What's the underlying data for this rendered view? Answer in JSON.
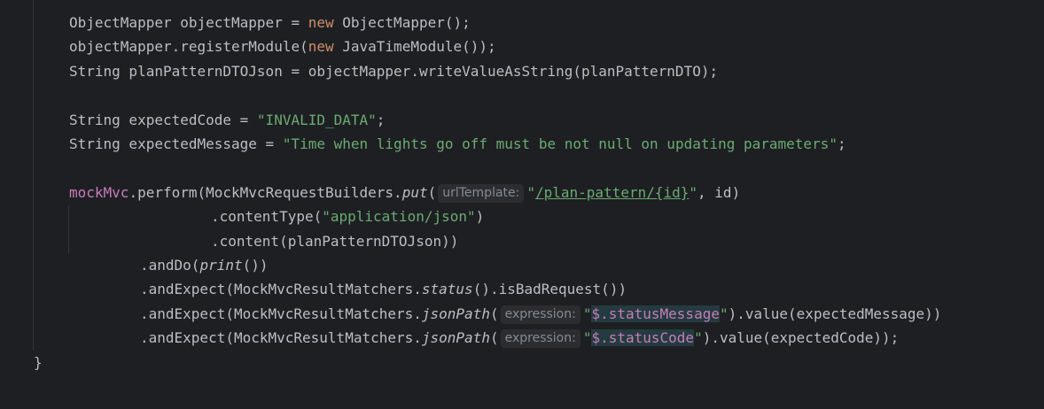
{
  "editor": {
    "lines": [
      {
        "indent": 4,
        "segments": [
          {
            "text": "ObjectMapper objectMapper = ",
            "cls": ""
          },
          {
            "text": "new",
            "cls": "kw"
          },
          {
            "text": " ObjectMapper();",
            "cls": ""
          }
        ]
      },
      {
        "indent": 4,
        "segments": [
          {
            "text": "objectMapper.registerModule(",
            "cls": ""
          },
          {
            "text": "new",
            "cls": "kw"
          },
          {
            "text": " JavaTimeModule());",
            "cls": ""
          }
        ]
      },
      {
        "indent": 4,
        "segments": [
          {
            "text": "String planPatternDTOJson = objectMapper.writeValueAsString(planPatternDTO);",
            "cls": ""
          }
        ]
      },
      {
        "indent": 0,
        "segments": []
      },
      {
        "indent": 4,
        "segments": [
          {
            "text": "String expectedCode = ",
            "cls": ""
          },
          {
            "text": "\"INVALID_DATA\"",
            "cls": "str"
          },
          {
            "text": ";",
            "cls": ""
          }
        ]
      },
      {
        "indent": 4,
        "segments": [
          {
            "text": "String expectedMessage = ",
            "cls": ""
          },
          {
            "text": "\"Time when lights go off must be not null on updating parameters\"",
            "cls": "str"
          },
          {
            "text": ";",
            "cls": ""
          }
        ]
      },
      {
        "indent": 0,
        "segments": []
      },
      {
        "indent": 4,
        "segments": [
          {
            "text": "mockMvc",
            "cls": "fld"
          },
          {
            "text": ".perform(MockMvcRequestBuilders.",
            "cls": ""
          },
          {
            "text": "put",
            "cls": "it"
          },
          {
            "text": "(",
            "cls": ""
          },
          {
            "hint": "urlTemplate:"
          },
          {
            "text": "\"",
            "cls": "str"
          },
          {
            "text": "/plan-pattern/{id}",
            "cls": "str url"
          },
          {
            "text": "\"",
            "cls": "str"
          },
          {
            "text": ", id)",
            "cls": ""
          }
        ]
      },
      {
        "indent": 20,
        "segments": [
          {
            "text": ".contentType(",
            "cls": ""
          },
          {
            "text": "\"application/json\"",
            "cls": "str"
          },
          {
            "text": ")",
            "cls": ""
          }
        ]
      },
      {
        "indent": 20,
        "segments": [
          {
            "text": ".content(planPatternDTOJson))",
            "cls": ""
          }
        ]
      },
      {
        "indent": 12,
        "segments": [
          {
            "text": ".andDo(",
            "cls": ""
          },
          {
            "text": "print",
            "cls": "it"
          },
          {
            "text": "())",
            "cls": ""
          }
        ]
      },
      {
        "indent": 12,
        "segments": [
          {
            "text": ".andExpect(MockMvcResultMatchers.",
            "cls": ""
          },
          {
            "text": "status",
            "cls": "it"
          },
          {
            "text": "().isBadRequest())",
            "cls": ""
          }
        ]
      },
      {
        "indent": 12,
        "segments": [
          {
            "text": ".andExpect(MockMvcResultMatchers.",
            "cls": ""
          },
          {
            "text": "jsonPath",
            "cls": "it"
          },
          {
            "text": "(",
            "cls": ""
          },
          {
            "hint": "expression:"
          },
          {
            "text": "\"",
            "cls": "str"
          },
          {
            "text": "$.statusMessage",
            "cls": "fld hl"
          },
          {
            "text": "\"",
            "cls": "str"
          },
          {
            "text": ").value(expectedMessage))",
            "cls": ""
          }
        ]
      },
      {
        "indent": 12,
        "segments": [
          {
            "text": ".andExpect(MockMvcResultMatchers.",
            "cls": ""
          },
          {
            "text": "jsonPath",
            "cls": "it"
          },
          {
            "text": "(",
            "cls": ""
          },
          {
            "hint": "expression:"
          },
          {
            "text": "\"",
            "cls": "str"
          },
          {
            "text": "$.statusCode",
            "cls": "fld hl"
          },
          {
            "text": "\"",
            "cls": "str"
          },
          {
            "text": ").value(expectedCode));",
            "cls": ""
          }
        ]
      },
      {
        "indent": 0,
        "segments": [
          {
            "text": "}",
            "cls": ""
          }
        ]
      }
    ]
  }
}
